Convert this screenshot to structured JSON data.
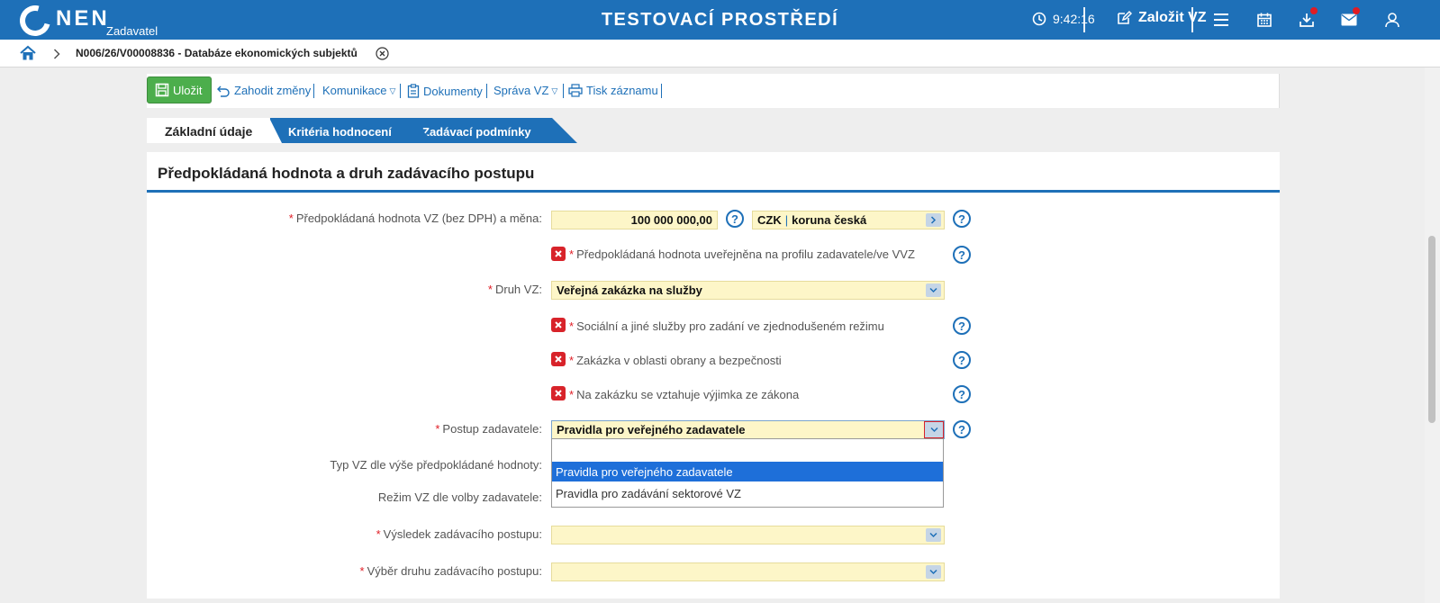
{
  "header": {
    "brand": "NEN",
    "brand_sub": "Zadavatel",
    "env_title": "TESTOVACÍ PROSTŘEDÍ",
    "time": "9:42:16",
    "new_vz_label": "Založit VZ",
    "icons": [
      "clock-icon",
      "edit-icon",
      "menu-icon",
      "calendar-icon",
      "download-icon",
      "mail-icon",
      "user-icon"
    ],
    "accent": "#1e70b8",
    "alert_color": "#e01c24"
  },
  "breadcrumb": {
    "text": "N006/26/V00008836 - Databáze ekonomických subjektů"
  },
  "toolbar": {
    "save": "Uložit",
    "discard": "Zahodit změny",
    "communication": "Komunikace",
    "documents": "Dokumenty",
    "manage_vz": "Správa VZ",
    "print": "Tisk záznamu"
  },
  "tabs": [
    {
      "label": "Základní údaje"
    },
    {
      "label": "Kritéria hodnocení"
    },
    {
      "label": "Zadávací podmínky"
    }
  ],
  "section": {
    "title": "Předpokládaná hodnota a druh zadávacího postupu"
  },
  "form": {
    "estimated_value": {
      "label": "Předpokládaná hodnota VZ (bez DPH) a měna:",
      "value": "100 000 000,00",
      "currency_code": "CZK",
      "currency_name": "koruna česká"
    },
    "published_check": "Předpokládaná hodnota uveřejněna na profilu zadavatele/ve VVZ",
    "druh_vz": {
      "label": "Druh VZ:",
      "value": "Veřejná zakázka na služby"
    },
    "social_check": "Sociální a jiné služby pro zadání ve zjednodušeném režimu",
    "defense_check": "Zakázka v oblasti obrany a bezpečnosti",
    "exception_check": "Na zakázku se vztahuje výjimka ze zákona",
    "postup": {
      "label": "Postup zadavatele:",
      "value": "Pravidla pro veřejného zadavatele",
      "options": [
        "",
        "Pravidla pro veřejného zadavatele",
        "Pravidla pro zadávání sektorové VZ"
      ]
    },
    "typ_vz_label": "Typ VZ dle výše předpokládané hodnoty:",
    "rezim_label": "Režim VZ dle volby zadavatele:",
    "vysledek": {
      "label": "Výsledek zadávacího postupu:",
      "value": ""
    },
    "vyber": {
      "label": "Výběr druhu zadávacího postupu:",
      "value": ""
    }
  }
}
